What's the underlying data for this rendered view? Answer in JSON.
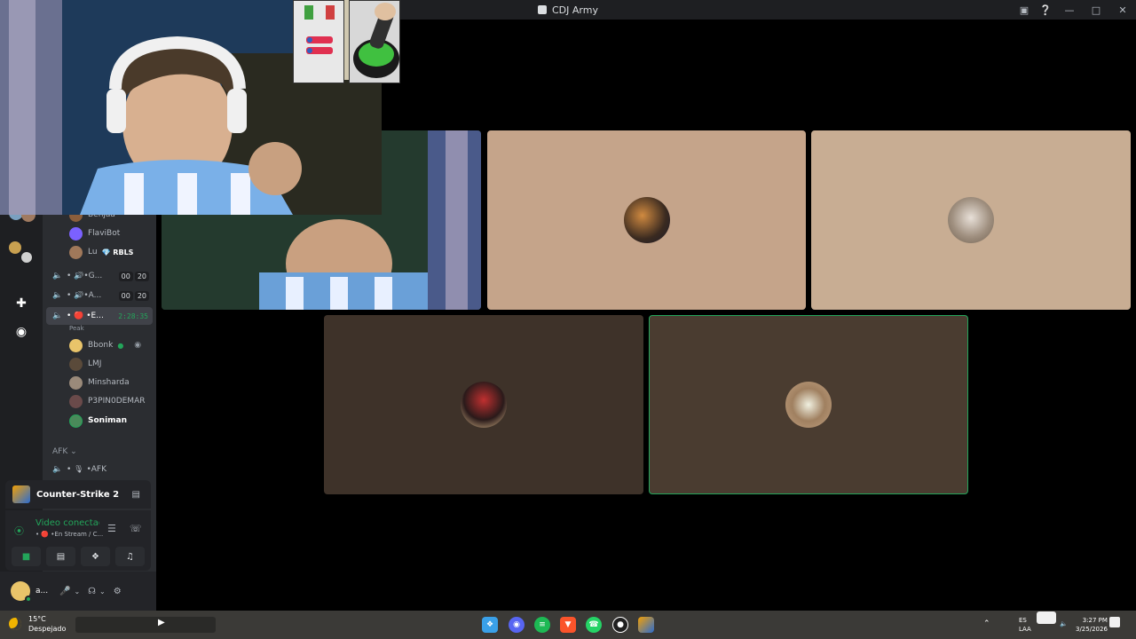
{
  "window": {
    "title": "CDJ Army"
  },
  "sidebar": {
    "users_top": [
      {
        "name": "Benjaa",
        "color": "#8b5e3c"
      },
      {
        "name": "FlaviBot",
        "color": "#7b61ff"
      },
      {
        "name": "Lu",
        "tag": "💎 RBLS",
        "color": "#a0785a"
      }
    ],
    "channels": [
      {
        "name": "• 🔊•G...",
        "counts": [
          "00",
          "20"
        ]
      },
      {
        "name": "• 🔊•A...",
        "counts": [
          "00",
          "20"
        ]
      }
    ],
    "active_channel": {
      "name": "• 🔴 •E...",
      "timer": "2:28:35",
      "peak": "Peak"
    },
    "members": [
      {
        "name": "Bbonk",
        "color": "#e9c46a"
      },
      {
        "name": "LMJ",
        "color": "#5a4a3a"
      },
      {
        "name": "Minsharda",
        "color": "#9a8a7a"
      },
      {
        "name": "P3PIN0DEMAR",
        "color": "#6a4a4a"
      },
      {
        "name": "Soniman",
        "color": "#4a8a5a"
      }
    ],
    "afk_header": "AFK",
    "afk_channel": "• 🎙 •AFK"
  },
  "activity": {
    "game": "Counter-Strike 2"
  },
  "voice": {
    "status": "Video conectado",
    "sub": "• 🔴 •En Stream / C..."
  },
  "user": {
    "name": "a..."
  },
  "taskbar": {
    "temp": "15°C",
    "condition": "Despejado",
    "lang": "ES",
    "layout": "LAA",
    "time": "3:27 PM",
    "date": "3/25/2026"
  },
  "colors": {
    "tile_peach": "#c5a48a",
    "tile_tan": "#c8ad93",
    "tile_brown": "#3e3229",
    "tile_brown2": "#4a3c30",
    "speaking_border": "#23a55a"
  }
}
